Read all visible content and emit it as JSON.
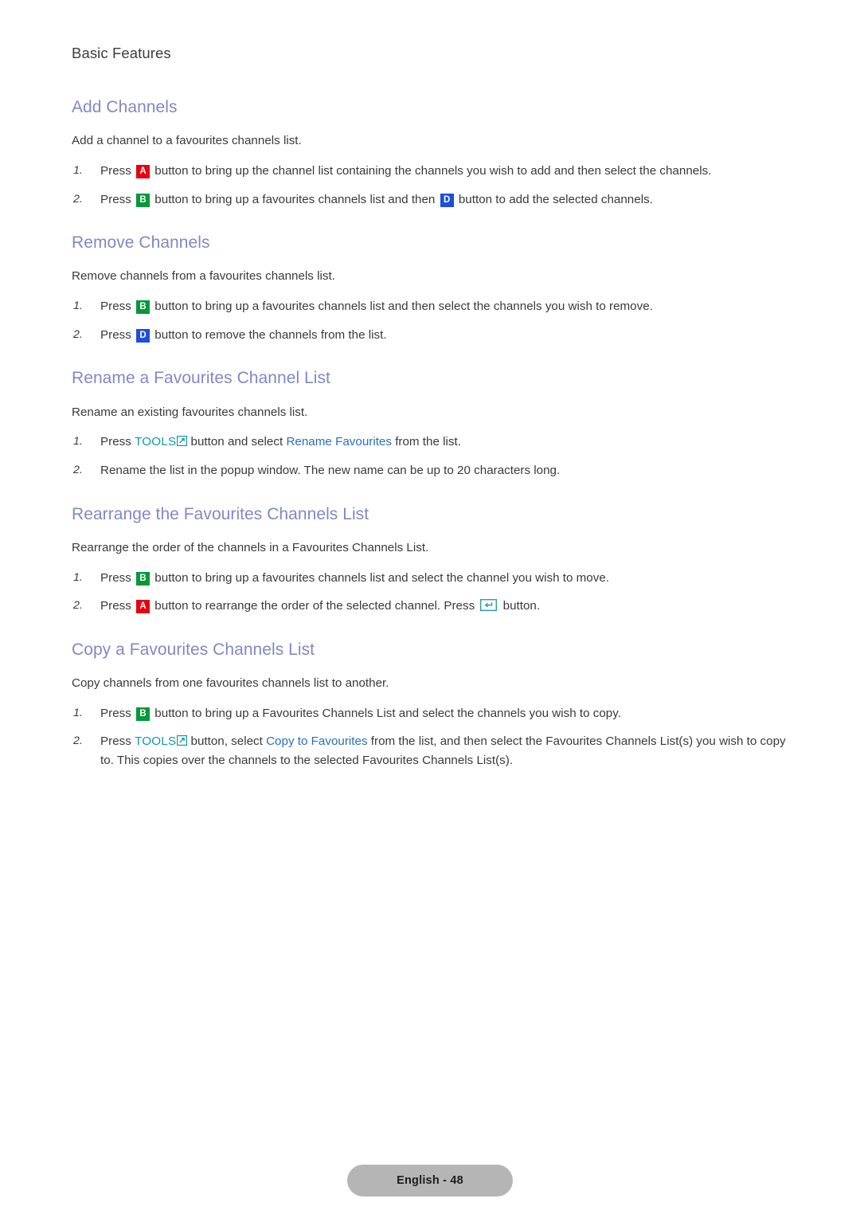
{
  "running_head": "Basic Features",
  "colors": {
    "heading": "#8287c4",
    "tools": "#1397a8",
    "menu_ref": "#2a6ebb",
    "key_a": "#e60012",
    "key_b": "#00983a",
    "key_d": "#1d4fd8",
    "footer_pill": "#b5b5b5"
  },
  "keys": {
    "a": "A",
    "b": "B",
    "d": "D"
  },
  "tools_label": "TOOLS",
  "sections": [
    {
      "title": "Add Channels",
      "lead": "Add a channel to a favourites channels list.",
      "steps": [
        {
          "part1": "Press",
          "part2": "button to bring up the channel list containing the channels you wish to add and then select the channels."
        },
        {
          "part1": "Press",
          "part2": "button to bring up a favourites channels list and then",
          "part3": "button to add the selected channels."
        }
      ]
    },
    {
      "title": "Remove Channels",
      "lead": "Remove channels from a favourites channels list.",
      "steps": [
        {
          "part1": "Press",
          "part2": "button to bring up a favourites channels list and then select the channels you wish to remove."
        },
        {
          "part1": "Press",
          "part2": "button to remove the channels from the list."
        }
      ]
    },
    {
      "title": "Rename a Favourites Channel List",
      "lead": "Rename an existing favourites channels list.",
      "steps": [
        {
          "part1": "Press",
          "part2": "button and select",
          "menu_ref": "Rename Favourites",
          "part3": "from the list."
        },
        {
          "full": "Rename the list in the popup window. The new name can be up to 20 characters long."
        }
      ]
    },
    {
      "title": "Rearrange the Favourites Channels List",
      "lead": "Rearrange the order of the channels in a Favourites Channels List.",
      "steps": [
        {
          "part1": "Press",
          "part2": "button to bring up a favourites channels list and select the channel you wish to move."
        },
        {
          "part1": "Press",
          "part2": "button to rearrange the order of the selected channel. Press",
          "part3": "button."
        }
      ]
    },
    {
      "title": "Copy a Favourites Channels List",
      "lead": "Copy channels from one favourites channels list to another.",
      "steps": [
        {
          "part1": "Press",
          "part2": "button to bring up a Favourites Channels List and select the channels you wish to copy."
        },
        {
          "part1": "Press",
          "part2": "button, select",
          "menu_ref": "Copy to Favourites",
          "part3": "from the list, and then select the Favourites Channels List(s) you wish to copy to. This copies over the channels to the selected Favourites Channels List(s)."
        }
      ]
    }
  ],
  "footer": {
    "label": "English - 48"
  }
}
